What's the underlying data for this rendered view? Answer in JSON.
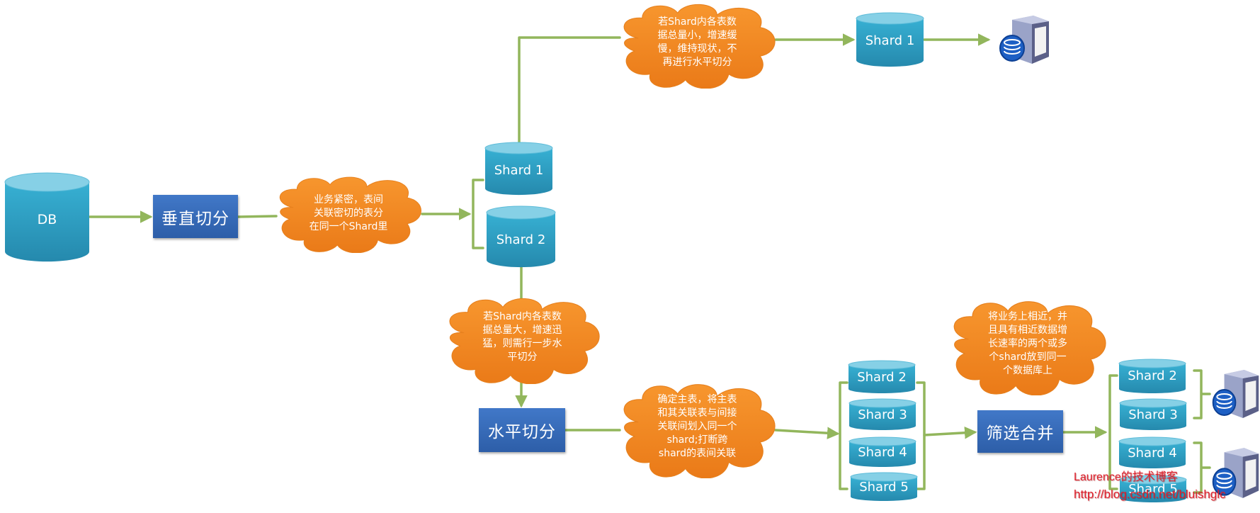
{
  "colors": {
    "cylinder_body": "#2ea3c7",
    "cylinder_top": "#86d0e6",
    "box": "#3366b8",
    "cloud": "#f28a24",
    "connector": "#92b65c",
    "watermark": "#e0202c"
  },
  "db": {
    "label": "DB"
  },
  "vertical_split": {
    "label": "垂直切分"
  },
  "cloud_vertical": {
    "text": "业务紧密，表间\n关联密切的表分\n在同一个Shard里"
  },
  "vertical_shards": [
    {
      "label": "Shard 1"
    },
    {
      "label": "Shard 2"
    }
  ],
  "cloud_small": {
    "text": "若Shard内各表数\n据总量小，增速缓\n慢，维持现状，不\n再进行水平切分"
  },
  "kept_shard": {
    "label": "Shard 1"
  },
  "cloud_large": {
    "text": "若Shard内各表数\n据总量大，增速迅\n猛，则需行一步水\n平切分"
  },
  "horizontal_split": {
    "label": "水平切分"
  },
  "cloud_horizontal": {
    "text": "确定主表，将主表\n和其关联表与间接\n关联间划入同一个\nshard;打断跨\nshard的表间关联"
  },
  "horizontal_shards": [
    {
      "label": "Shard 2"
    },
    {
      "label": "Shard 3"
    },
    {
      "label": "Shard 4"
    },
    {
      "label": "Shard 5"
    }
  ],
  "merge": {
    "label": "筛选合并"
  },
  "cloud_merge": {
    "text": "将业务上相近，并\n且具有相近数据增\n长速率的两个或多\n个shard放到同一\n个数据库上"
  },
  "merged_shards": [
    {
      "label": "Shard 2"
    },
    {
      "label": "Shard 3"
    },
    {
      "label": "Shard 4"
    },
    {
      "label": "Shard 5"
    }
  ],
  "servers": [
    {
      "icon": "database-server-icon"
    },
    {
      "icon": "database-server-icon"
    },
    {
      "icon": "database-server-icon"
    }
  ],
  "watermark": {
    "line1": "Laurence的技术博客",
    "line2": "http://blog.csdn.net/bluishglc"
  }
}
